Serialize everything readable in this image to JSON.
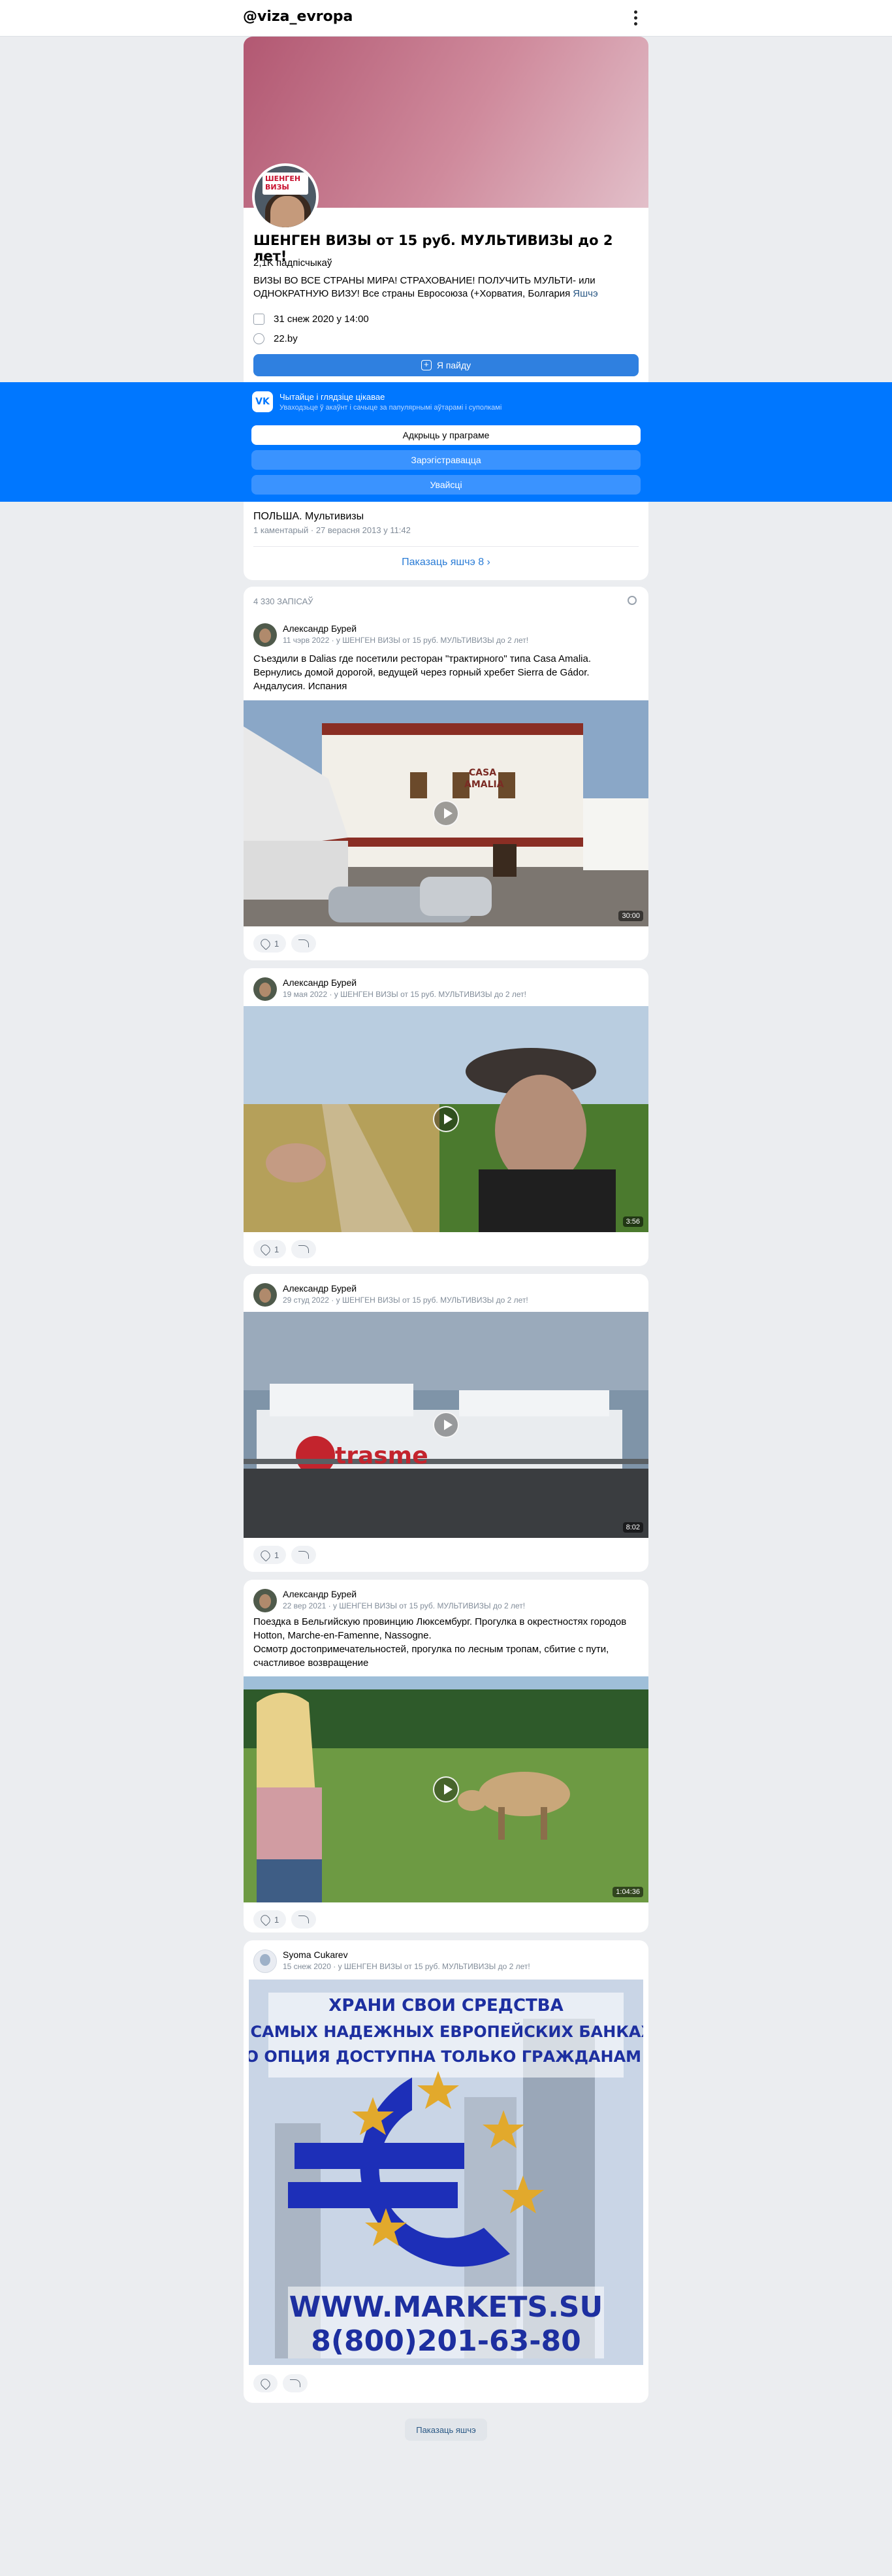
{
  "topbar": {
    "handle": "@viza_evropa"
  },
  "profile": {
    "logo_text": "ШЕНГЕН ВИЗЫ",
    "name": "ШЕНГЕН ВИЗЫ от 15 руб. МУЛЬТИВИЗЫ до 2 лет!",
    "subscribers": "2,1K падпісчыкаў",
    "description": "ВИЗЫ ВО ВСЕ СТРАНЫ МИРА! СТРАХОВАНИЕ! ПОЛУЧИТЬ МУЛЬТИ- или ОДНОКРАТНУЮ ВИЗУ! Все страны Евросоюза (+Хорватия, Болгария",
    "description_more": "Яшчэ",
    "date": "31 снеж 2020 у 14:00",
    "site": "22.by",
    "join_label": "Я пайду"
  },
  "overlay": {
    "logo": "VK",
    "title": "Чытайце і глядзіце цікавае",
    "subtitle": "Уваходзьце ў акаўнт і сачыце за папулярнымі аўтарамі і суполкамі",
    "btn_app": "Адкрыць у праграме",
    "btn_register": "Зарэгістравацца",
    "btn_login": "Увайсці"
  },
  "discussion": {
    "title": "ПОЛЬША. Мультивизы",
    "meta": "1 каментарый · 27 верасня 2013 у 11:42",
    "more": "Паказаць яшчэ 8"
  },
  "feed": {
    "count": "4 330 ЗАПІСАЎ"
  },
  "posts": [
    {
      "author": "Александр Бурей",
      "meta": "11 чэрв 2022 · у ШЕНГЕН ВИЗЫ от 15 руб. МУЛЬТИВИЗЫ до 2 лет!",
      "text": "Съездили в Dalias где посетили ресторан \"трактирного\" типа Casa Amalia. Вернулись домой дорогой, ведущей через горный хребет Sierra de Gádor. Андалусия. Испания",
      "duration": "30:00",
      "likes": "1",
      "sign1": "CASA",
      "sign2": "AMALIA"
    },
    {
      "author": "Александр Бурей",
      "meta": "19 мая 2022 · у ШЕНГЕН ВИЗЫ от 15 руб. МУЛЬТИВИЗЫ до 2 лет!",
      "text": "",
      "duration": "3:56",
      "likes": "1"
    },
    {
      "author": "Александр Бурей",
      "meta": "29 студ 2022 · у ШЕНГЕН ВИЗЫ от 15 руб. МУЛЬТИВИЗЫ до 2 лет!",
      "text": "",
      "duration": "8:02",
      "likes": "1",
      "ship_text": "trasme"
    },
    {
      "author": "Александр Бурей",
      "meta": "22 вер 2021 · у ШЕНГЕН ВИЗЫ от 15 руб. МУЛЬТИВИЗЫ до 2 лет!",
      "text_lines": [
        "Поездка в Бельгийскую провинцию Люксембург. Прогулка в окрестностях городов Hotton, Marche-en-Famenne, Nassogne.",
        "Осмотр достопримечательностей, прогулка по лесным тропам, сбитие с пути, счастливое возвращение"
      ],
      "duration": "1:04:36",
      "likes": "1"
    },
    {
      "author": "Syoma Cukarev",
      "meta": "15 снеж 2020 · у ШЕНГЕН ВИЗЫ от 15 руб. МУЛЬТИВИЗЫ до 2 лет!",
      "ad_line1": "ХРАНИ СВОИ СРЕДСТВА",
      "ad_line2": "В САМЫХ НАДЕЖНЫХ ЕВРОПЕЙСКИХ БАНКАХ,",
      "ad_line3": "ЭТО ОПЦИЯ ДОСТУПНА ТОЛЬКО ГРАЖДАНАМ ЕС",
      "ad_url": "WWW.MARKETS.SU",
      "ad_phone": "8(800)201-63-80"
    }
  ],
  "footer": {
    "show_more": "Паказаць яшчэ"
  }
}
